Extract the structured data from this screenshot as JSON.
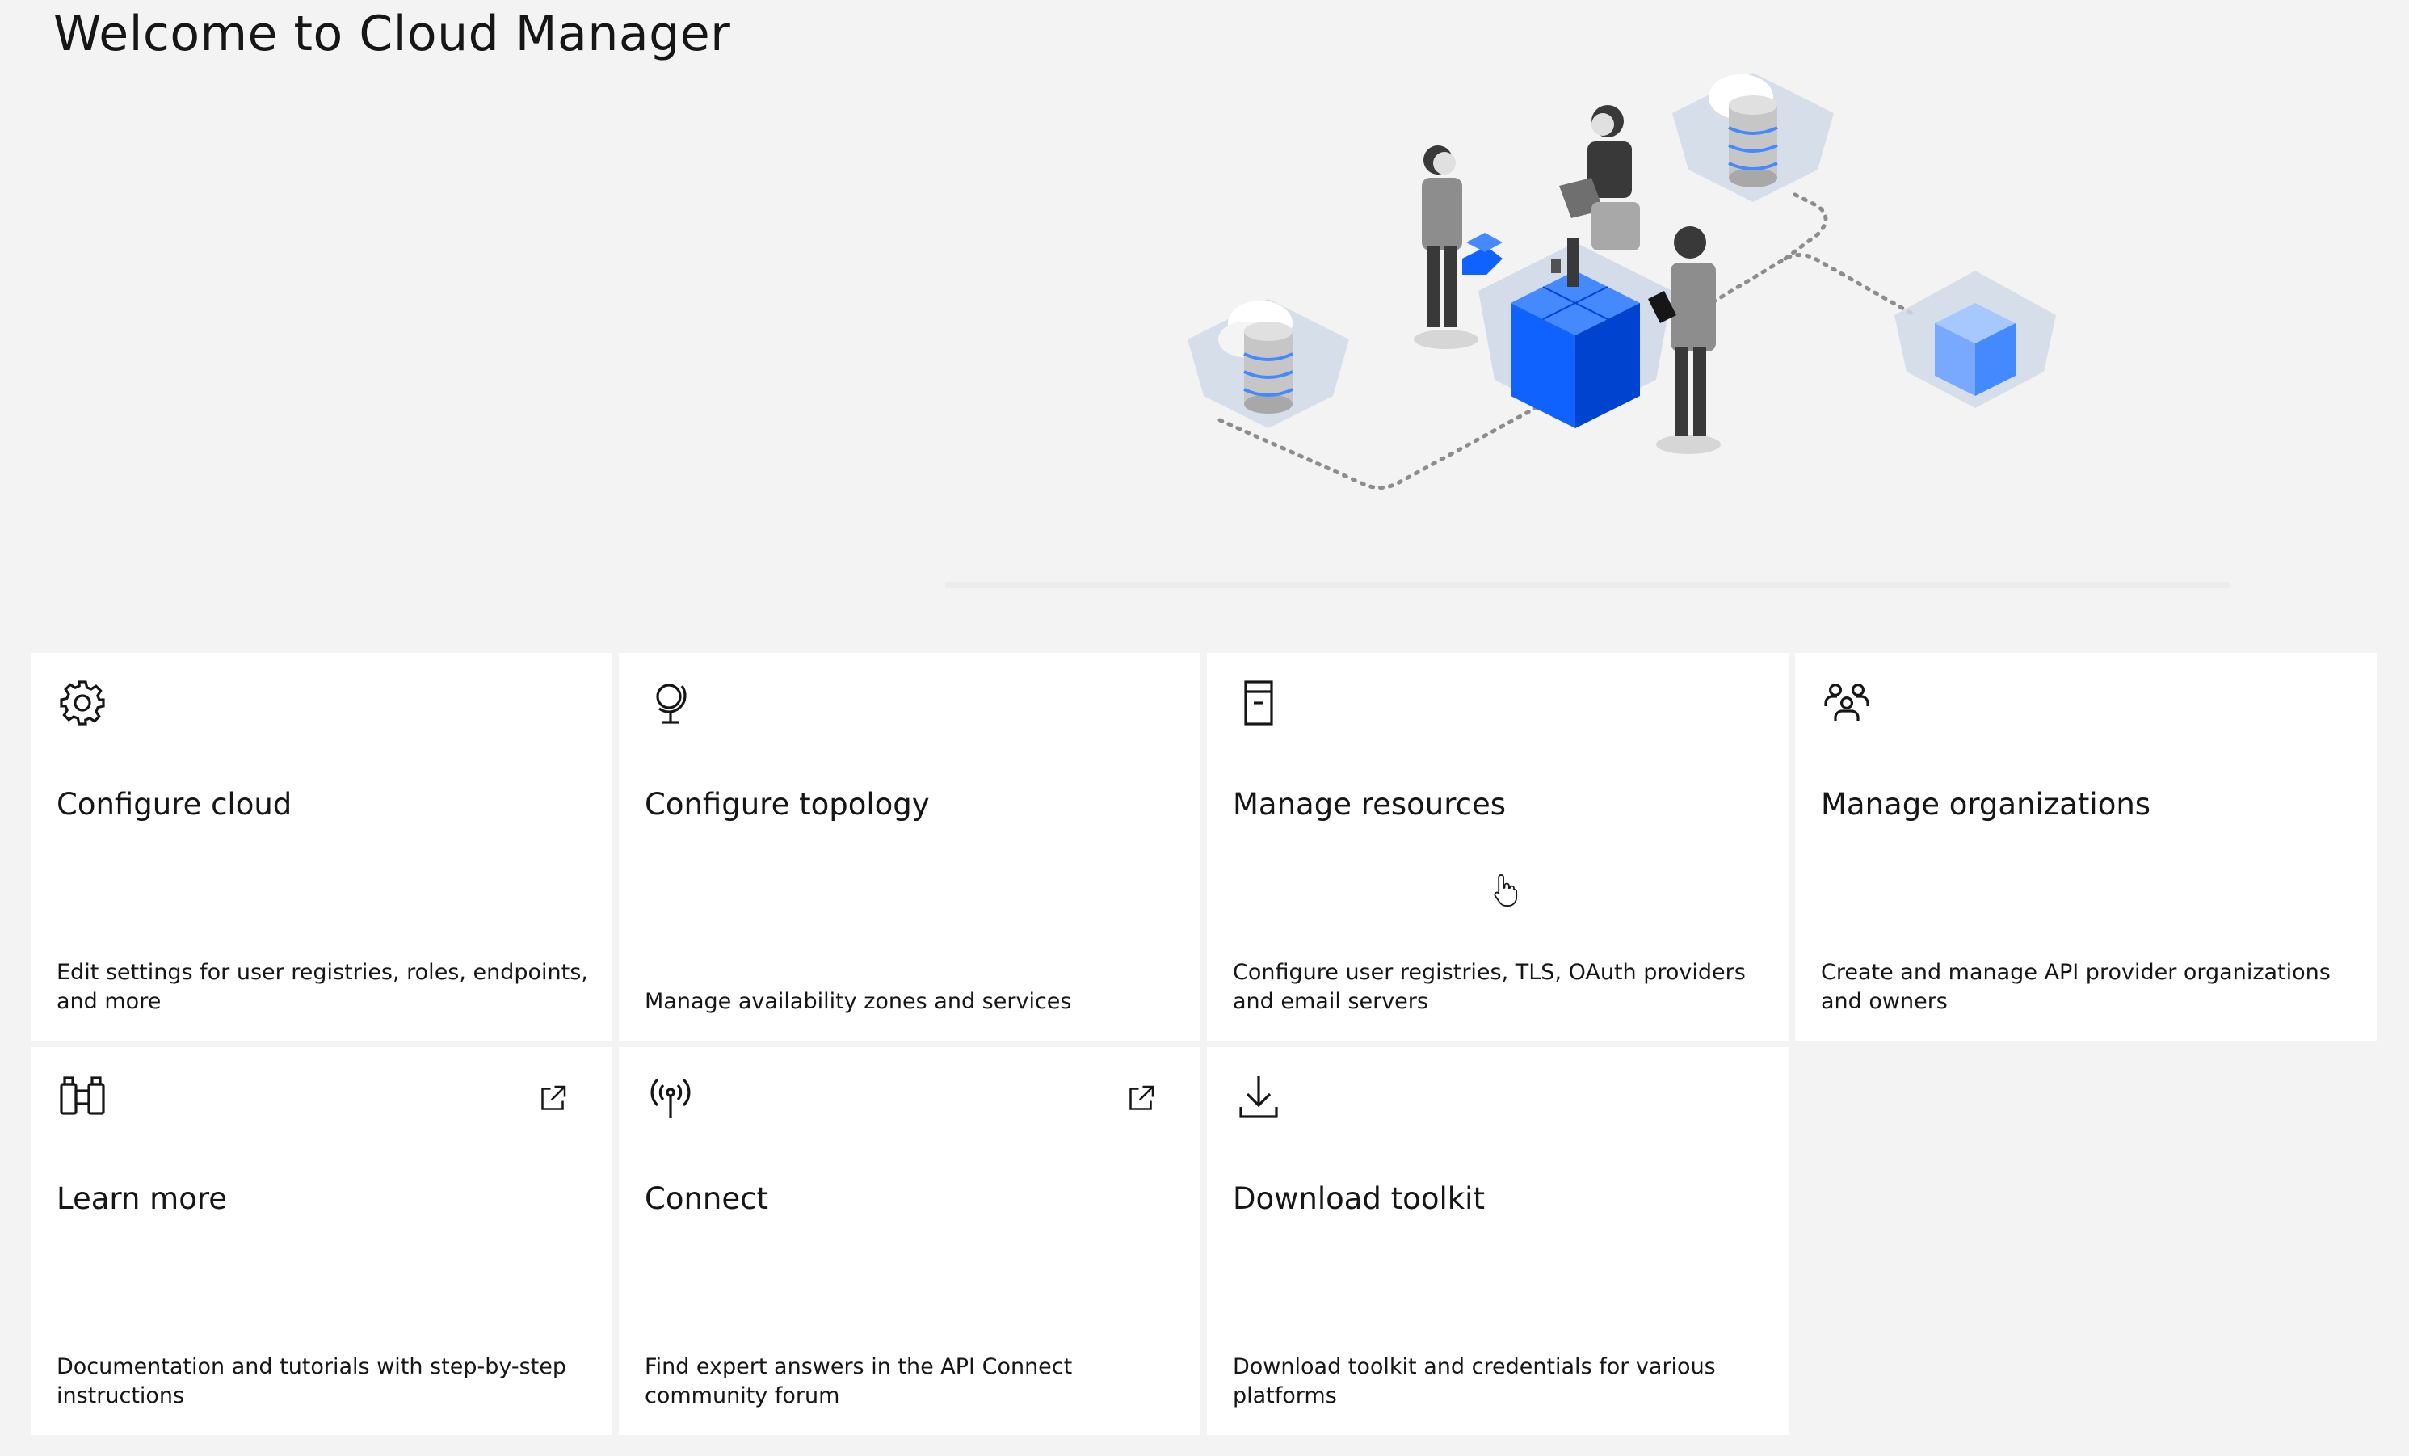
{
  "header": {
    "title": "Welcome to Cloud Manager"
  },
  "tiles": [
    {
      "title": "Configure cloud",
      "description": "Edit settings for user registries, roles, endpoints, and more",
      "icon": "settings-icon"
    },
    {
      "title": "Configure topology",
      "description": "Manage availability zones and services",
      "icon": "globe-icon"
    },
    {
      "title": "Manage resources",
      "description": "Configure user registries, TLS, OAuth providers and email servers",
      "icon": "server-icon"
    },
    {
      "title": "Manage organizations",
      "description": "Create and manage API provider organizations and owners",
      "icon": "users-icon"
    },
    {
      "title": "Learn more",
      "description": "Documentation and tutorials with step-by-step instructions",
      "icon": "binoculars-icon",
      "external": true
    },
    {
      "title": "Connect",
      "description": "Find expert answers in the API Connect community forum",
      "icon": "antenna-icon",
      "external": true
    },
    {
      "title": "Download toolkit",
      "description": "Download toolkit and credentials for various platforms",
      "icon": "download-icon"
    }
  ],
  "colors": {
    "background": "#f3f3f3",
    "tile": "#ffffff",
    "text": "#161616",
    "accent_blue": "#0f62fe"
  }
}
